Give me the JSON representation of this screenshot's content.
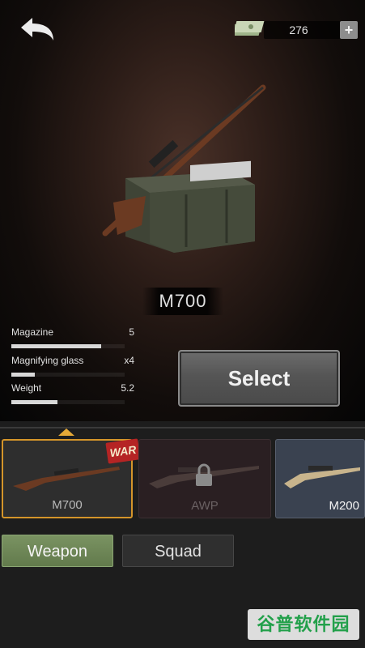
{
  "currency": {
    "value": "276",
    "plus_label": "+"
  },
  "weapon": {
    "name": "M700"
  },
  "stats": [
    {
      "label": "Magazine",
      "value": "5",
      "fill": 0.79
    },
    {
      "label": "Magnifying glass",
      "value": "x4",
      "fill": 0.21
    },
    {
      "label": "Weight",
      "value": "5.2",
      "fill": 0.41
    }
  ],
  "select_label": "Select",
  "cards": [
    {
      "label": "M700",
      "tag": "WAR",
      "selected": true
    },
    {
      "label": "AWP",
      "locked": true
    },
    {
      "label": "M200"
    }
  ],
  "tabs": {
    "weapon": "Weapon",
    "squad": "Squad"
  },
  "watermark": "谷普软件园",
  "colors": {
    "accent": "#d4952a",
    "tab_active": "#6e8856",
    "war_tag": "#b52424"
  }
}
